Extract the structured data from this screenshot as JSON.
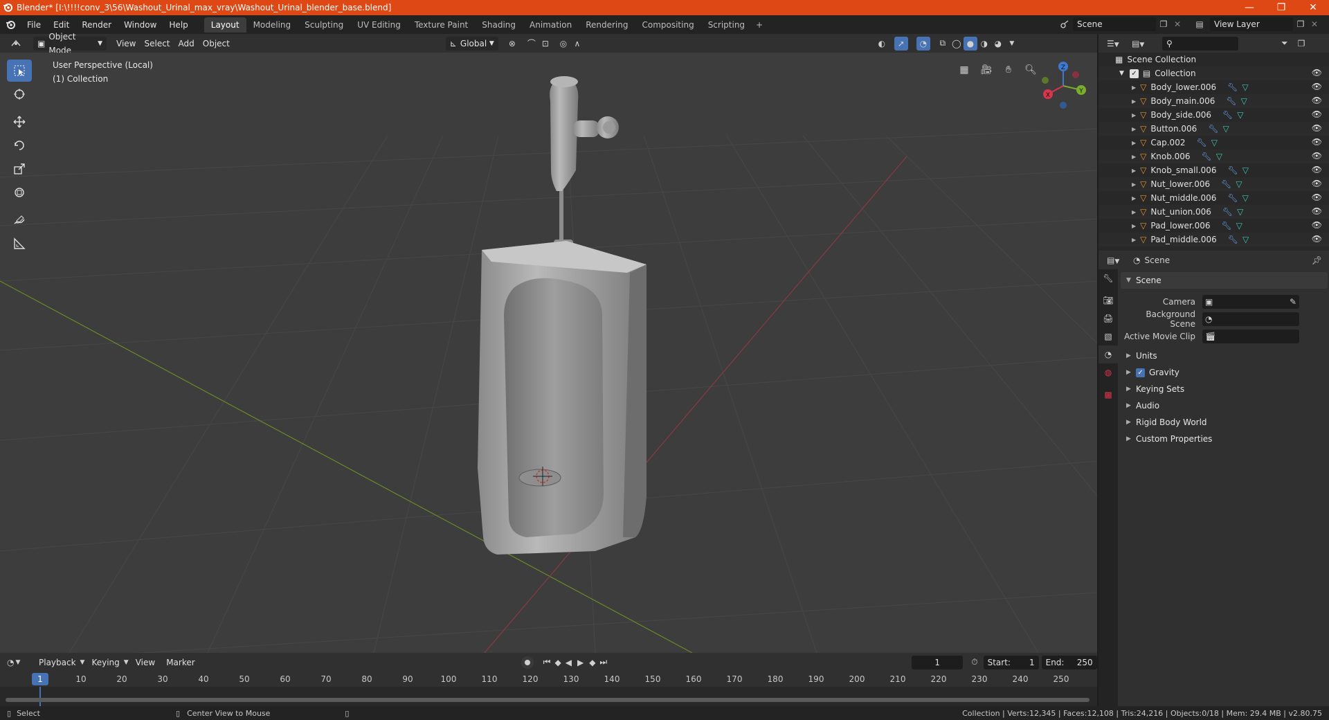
{
  "window": {
    "title": "Blender* [I:\\!!!!conv_3\\56\\Washout_Urinal_max_vray\\Washout_Urinal_blender_base.blend]",
    "controls": [
      "—",
      "❐",
      "✕"
    ]
  },
  "menu": {
    "items": [
      "File",
      "Edit",
      "Render",
      "Window",
      "Help"
    ],
    "workspaces": [
      "Layout",
      "Modeling",
      "Sculpting",
      "UV Editing",
      "Texture Paint",
      "Shading",
      "Animation",
      "Rendering",
      "Compositing",
      "Scripting"
    ],
    "active_workspace": "Layout",
    "add_workspace": "+",
    "scene": "Scene",
    "view_layer": "View Layer"
  },
  "viewport_header": {
    "mode": "Object Mode",
    "menus": [
      "View",
      "Select",
      "Add",
      "Object"
    ],
    "orientation": "Global"
  },
  "viewport": {
    "perspective": "User Perspective (Local)",
    "collection": "(1) Collection",
    "gizmo_axes": [
      "X",
      "Y",
      "Z"
    ]
  },
  "timeline": {
    "menus": [
      "Playback",
      "Keying",
      "View",
      "Marker"
    ],
    "current_frame": "1",
    "start_label": "Start:",
    "start": "1",
    "end_label": "End:",
    "end": "250",
    "ruler": [
      "1",
      "10",
      "20",
      "30",
      "40",
      "50",
      "60",
      "70",
      "80",
      "90",
      "100",
      "110",
      "120",
      "130",
      "140",
      "150",
      "160",
      "170",
      "180",
      "190",
      "200",
      "210",
      "220",
      "230",
      "240",
      "250"
    ]
  },
  "outliner": {
    "root": "Scene Collection",
    "collection": "Collection",
    "objects": [
      "Body_lower.006",
      "Body_main.006",
      "Body_side.006",
      "Button.006",
      "Cap.002",
      "Knob.006",
      "Knob_small.006",
      "Nut_lower.006",
      "Nut_middle.006",
      "Nut_union.006",
      "Pad_lower.006",
      "Pad_middle.006"
    ]
  },
  "properties": {
    "context": "Scene",
    "panel": "Scene",
    "fields": [
      {
        "label": "Camera",
        "value": ""
      },
      {
        "label": "Background Scene",
        "value": ""
      },
      {
        "label": "Active Movie Clip",
        "value": ""
      }
    ],
    "sub_panels": [
      "Units",
      "Gravity",
      "Keying Sets",
      "Audio",
      "Rigid Body World",
      "Custom Properties"
    ]
  },
  "status": {
    "left_action": "Select",
    "middle_action": "Center View to Mouse",
    "stats": "Collection | Verts:12,345 | Faces:12,108 | Tris:24,216 | Objects:0/18 | Mem: 29.4 MB | v2.80.75"
  },
  "colors": {
    "titlebar": "#dd4814",
    "accent": "#4772b3",
    "object_icon": "#e8902b",
    "mesh_icon": "#3fc5b0",
    "viewport_bg": "#3d3d3d"
  }
}
